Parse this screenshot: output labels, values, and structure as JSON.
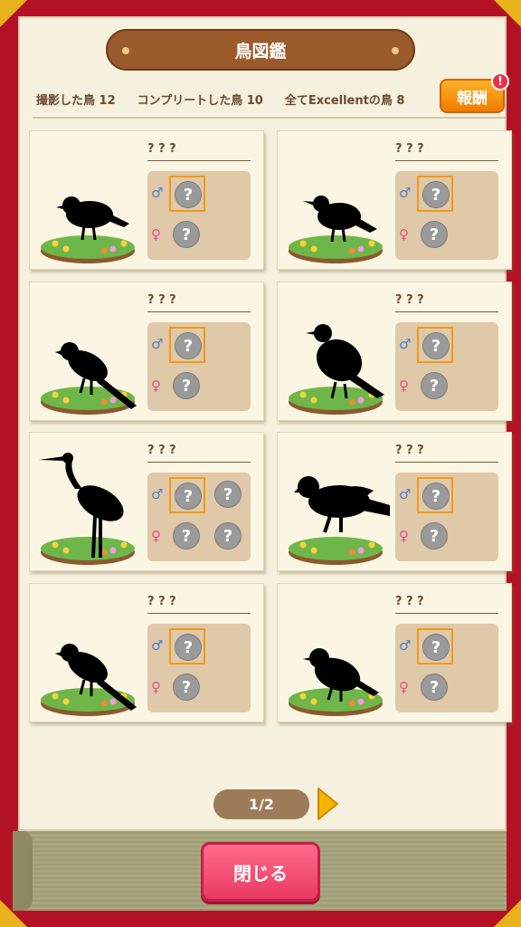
{
  "title": "鳥図鑑",
  "stats": {
    "photographed": "撮影した鳥 12",
    "completed": "コンプリートした鳥 10",
    "excellent": "全てExcellentの鳥 8"
  },
  "reward_button": "報酬",
  "reward_badge": "!",
  "male_symbol": "♂",
  "female_symbol": "♀",
  "unknown_mark": "?",
  "cards": [
    {
      "name": "? ? ?",
      "bird": "sparrow-silhouette",
      "slots_per_row": 1
    },
    {
      "name": "? ? ?",
      "bird": "starling-silhouette",
      "slots_per_row": 1
    },
    {
      "name": "? ? ?",
      "bird": "wagtail-silhouette",
      "slots_per_row": 1
    },
    {
      "name": "? ? ?",
      "bird": "thrush-silhouette",
      "slots_per_row": 1
    },
    {
      "name": "? ? ?",
      "bird": "heron-silhouette",
      "slots_per_row": 2
    },
    {
      "name": "? ? ?",
      "bird": "hawk-silhouette",
      "slots_per_row": 1
    },
    {
      "name": "? ? ?",
      "bird": "wagtail-silhouette",
      "slots_per_row": 1
    },
    {
      "name": "? ? ?",
      "bird": "robin-silhouette",
      "slots_per_row": 1
    }
  ],
  "pager": "1/2",
  "close_button": "閉じる",
  "colors": {
    "frame": "#b31225",
    "page": "#f6f1df",
    "accent": "#f29a15",
    "close": "#e83a62"
  }
}
